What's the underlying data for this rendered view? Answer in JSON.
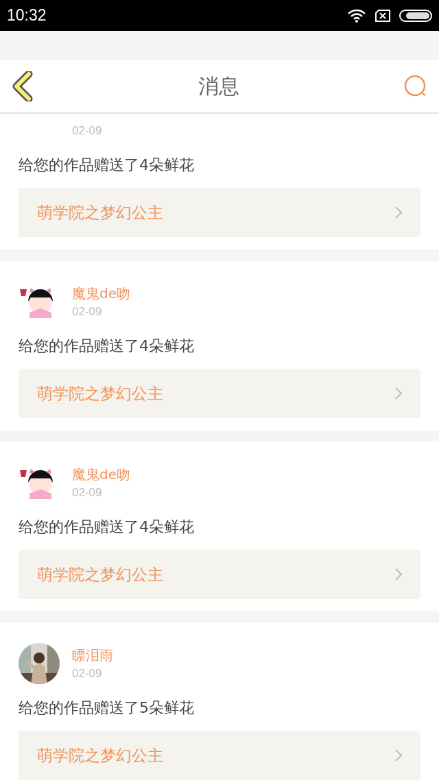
{
  "status_bar": {
    "time": "10:32"
  },
  "header": {
    "title": "消息"
  },
  "messages": [
    {
      "kind": "partial",
      "date": "02-09",
      "text": "给您的作品赠送了4朵鲜花",
      "work": "萌学院之梦幻公主"
    },
    {
      "kind": "cartoon",
      "name": "魔鬼de吻",
      "date": "02-09",
      "text": "给您的作品赠送了4朵鲜花",
      "work": "萌学院之梦幻公主"
    },
    {
      "kind": "cartoon",
      "name": "魔鬼de吻",
      "date": "02-09",
      "text": "给您的作品赠送了4朵鲜花",
      "work": "萌学院之梦幻公主"
    },
    {
      "name": "瞟泪雨",
      "date": "02-09",
      "text": "给您的作品赠送了5朵鲜花",
      "work": "萌学院之梦幻公主"
    }
  ]
}
